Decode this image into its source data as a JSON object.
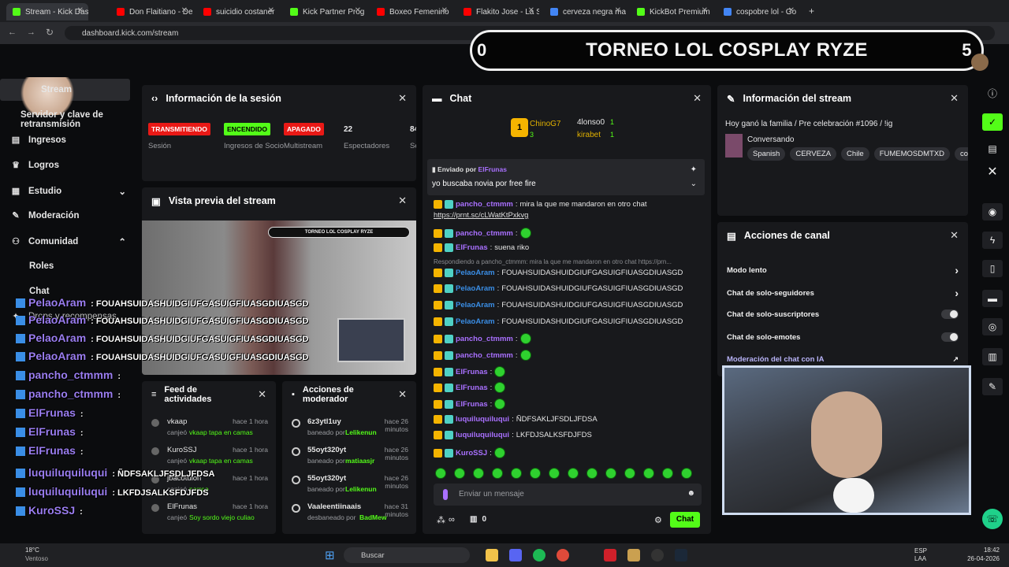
{
  "browser": {
    "tabs": [
      {
        "label": "Stream - Kick Dash",
        "color": "#53fc18"
      },
      {
        "label": "Don Flaitiano - De",
        "color": "#ff0000"
      },
      {
        "label": "suicidio costaner",
        "color": "#ff0000"
      },
      {
        "label": "Kick Partner Prog",
        "color": "#53fc18"
      },
      {
        "label": "Boxeo Femenino",
        "color": "#ff0000"
      },
      {
        "label": "Flakito Jose - La S",
        "color": "#ff0000"
      },
      {
        "label": "cerveza negra ma",
        "color": "#4285f4"
      },
      {
        "label": "KickBot Premium",
        "color": "#53fc18"
      },
      {
        "label": "cospobre lol - Go",
        "color": "#4285f4"
      }
    ],
    "url": "dashboard.kick.com/stream"
  },
  "banner": {
    "title": "TORNEO LOL COSPLAY RYZE",
    "left": "0",
    "right": "5"
  },
  "sidebar": {
    "items": [
      {
        "label": "Stream",
        "icon": "video-icon"
      },
      {
        "label": "Servidor y clave de retransmisión",
        "icon": "key-icon"
      },
      {
        "label": "Ingresos",
        "icon": "money-icon"
      },
      {
        "label": "Logros",
        "icon": "trophy-icon"
      },
      {
        "label": "Estudio",
        "icon": "studio-icon"
      },
      {
        "label": "Moderación",
        "icon": "wrench-icon"
      },
      {
        "label": "Comunidad",
        "icon": "community-icon"
      },
      {
        "label": "Roles",
        "icon": ""
      },
      {
        "label": "Chat",
        "icon": ""
      },
      {
        "label": "Drops y recompensas",
        "icon": "gift-icon"
      }
    ]
  },
  "session": {
    "title": "Información de la sesión",
    "stats": [
      {
        "badge": "TRANSMITIENDO",
        "label": "Sesión",
        "color": "#e91916",
        "text": "#fff"
      },
      {
        "badge": "ENCENDIDO",
        "label": "Ingresos de Socio",
        "color": "#53fc18",
        "text": "#000"
      },
      {
        "badge": "APAGADO",
        "label": "Multistream",
        "color": "#e91916",
        "text": "#fff"
      },
      {
        "badge": "22",
        "label": "Espectadores",
        "color": "",
        "text": "#fff"
      },
      {
        "badge": "84",
        "label": "Se",
        "color": "",
        "text": "#fff"
      }
    ]
  },
  "preview": {
    "title": "Vista previa del stream",
    "banner": "TORNEO LOL COSPLAY RYZE"
  },
  "feed": {
    "title": "Feed de actividades",
    "items": [
      {
        "user": "vkaap",
        "time": "hace 1 hora",
        "action": "canjeó",
        "reward": "vkaap tapa en camas"
      },
      {
        "user": "KuroSSJ",
        "time": "hace 1 hora",
        "action": "canjeó",
        "reward": "vkaap tapa en camas"
      },
      {
        "user": "jbacotulon",
        "time": "hace 1 hora",
        "action": "canjeó",
        "reward": "perree"
      },
      {
        "user": "ElFrunas",
        "time": "hace 1 hora",
        "action": "canjeó",
        "reward": "Soy sordo viejo culiao"
      }
    ]
  },
  "modactions": {
    "title": "Acciones de moderador",
    "items": [
      {
        "user": "6z3ytl1uy",
        "time": "hace 26 minutos",
        "action": "baneado por",
        "by": "Lelikenun"
      },
      {
        "user": "55oyt320yt",
        "time": "hace 26 minutos",
        "action": "baneado por",
        "by": "matiaasjr"
      },
      {
        "user": "55oyt320yt",
        "time": "hace 26 minutos",
        "action": "baneado por",
        "by": "Lelikenun"
      },
      {
        "user": "Vaaleentiinaais",
        "time": "hace 31 minutos",
        "action": "desbaneado por",
        "by": "BadMew"
      }
    ]
  },
  "chat": {
    "title": "Chat",
    "top": [
      {
        "rank": "1",
        "user": "ChinoG7",
        "count": "3"
      },
      {
        "rank": "",
        "user": "4lonso0",
        "count": "1"
      },
      {
        "rank": "",
        "user": "kirabet",
        "count": "1"
      }
    ],
    "pinned": {
      "by_label": "Enviado por",
      "by": "ElFrunas",
      "text": "yo buscaba novia por free fire"
    },
    "messages": [
      {
        "user": "pancho_ctmmm",
        "color": "#a970ff",
        "text": "mira la que me mandaron en otro chat"
      },
      {
        "user": "",
        "color": "",
        "text": "https://prnt.sc/cLWatKtPxkvg"
      },
      {
        "user": "pancho_ctmmm",
        "color": "#a970ff",
        "text": ""
      },
      {
        "user": "ElFrunas",
        "color": "#a970ff",
        "text": "suena riko"
      },
      {
        "user": "",
        "color": "",
        "text": "Respondiendo a pancho_ctmmm: mira la que me mandaron en otro chat https://prn..."
      },
      {
        "user": "PelaoAram",
        "color": "#3a8ee6",
        "text": "FOUAHSUIDASHUIDGIUFGASUIGFIUASGDIUASGD"
      },
      {
        "user": "PelaoAram",
        "color": "#3a8ee6",
        "text": "FOUAHSUIDASHUIDGIUFGASUIGFIUASGDIUASGD"
      },
      {
        "user": "PelaoAram",
        "color": "#3a8ee6",
        "text": "FOUAHSUIDASHUIDGIUFGASUIGFIUASGDIUASGD"
      },
      {
        "user": "PelaoAram",
        "color": "#3a8ee6",
        "text": "FOUAHSUIDASHUIDGIUFGASUIGFIUASGDIUASGD"
      },
      {
        "user": "pancho_ctmmm",
        "color": "#a970ff",
        "text": ""
      },
      {
        "user": "pancho_ctmmm",
        "color": "#a970ff",
        "text": ""
      },
      {
        "user": "ElFrunas",
        "color": "#a970ff",
        "text": ""
      },
      {
        "user": "ElFrunas",
        "color": "#a970ff",
        "text": ""
      },
      {
        "user": "ElFrunas",
        "color": "#a970ff",
        "text": ""
      },
      {
        "user": "luquiluquiluqui",
        "color": "#a970ff",
        "text": "ÑDFSAKLJFSDLJFDSA"
      },
      {
        "user": "luquiluquiluqui",
        "color": "#a970ff",
        "text": "LKFDJSALKSFDJFDS"
      },
      {
        "user": "KuroSSJ",
        "color": "#a970ff",
        "text": ""
      }
    ],
    "input_placeholder": "Enviar un mensaje",
    "send_label": "Chat",
    "infinity": "∞",
    "points": "0"
  },
  "streaminfo": {
    "title": "Información del stream",
    "stream_title": "Hoy ganó la familia / Pre celebración #1096 / !ig",
    "category": "Conversando",
    "tags": [
      "Spanish",
      "CERVEZA",
      "Chile",
      "FUMEMOSDMTXD",
      "coo"
    ]
  },
  "channel": {
    "title": "Acciones de canal",
    "items": [
      {
        "label": "Modo lento",
        "control": "arrow"
      },
      {
        "label": "Chat de solo-seguidores",
        "control": "arrow"
      },
      {
        "label": "Chat de solo-suscriptores",
        "control": "toggle"
      },
      {
        "label": "Chat de solo-emotes",
        "control": "toggle"
      },
      {
        "label": "Moderación del chat con IA",
        "control": "link"
      }
    ]
  },
  "overlay": [
    {
      "user": "PelaoAram",
      "msg": ": FOUAHSUIDASHUIDGIUFGASUIGFIUASGDIUASGD"
    },
    {
      "user": "PelaoAram",
      "msg": ": FOUAHSUIDASHUIDGIUFGASUIGFIUASGDIUASGD"
    },
    {
      "user": "PelaoAram",
      "msg": ": FOUAHSUIDASHUIDGIUFGASUIGFIUASGDIUASGD"
    },
    {
      "user": "PelaoAram",
      "msg": ": FOUAHSUIDASHUIDGIUFGASUIGFIUASGDIUASGD"
    },
    {
      "user": "pancho_ctmmm",
      "msg": ":"
    },
    {
      "user": "pancho_ctmmm",
      "msg": ":"
    },
    {
      "user": "ElFrunas",
      "msg": ":"
    },
    {
      "user": "ElFrunas",
      "msg": ":"
    },
    {
      "user": "ElFrunas",
      "msg": ":"
    },
    {
      "user": "luquiluquiluqui",
      "msg": ": ÑDFSAKLJFSDLJFDSA"
    },
    {
      "user": "luquiluquiluqui",
      "msg": ": LKFDJSALKSFDJFDS"
    },
    {
      "user": "KuroSSJ",
      "msg": ":"
    }
  ],
  "taskbar": {
    "weather_temp": "18°C",
    "weather_text": "Ventoso",
    "search": "Buscar",
    "lang1": "ESP",
    "lang2": "LAA",
    "time": "18:42",
    "date": "26-04-2026"
  }
}
